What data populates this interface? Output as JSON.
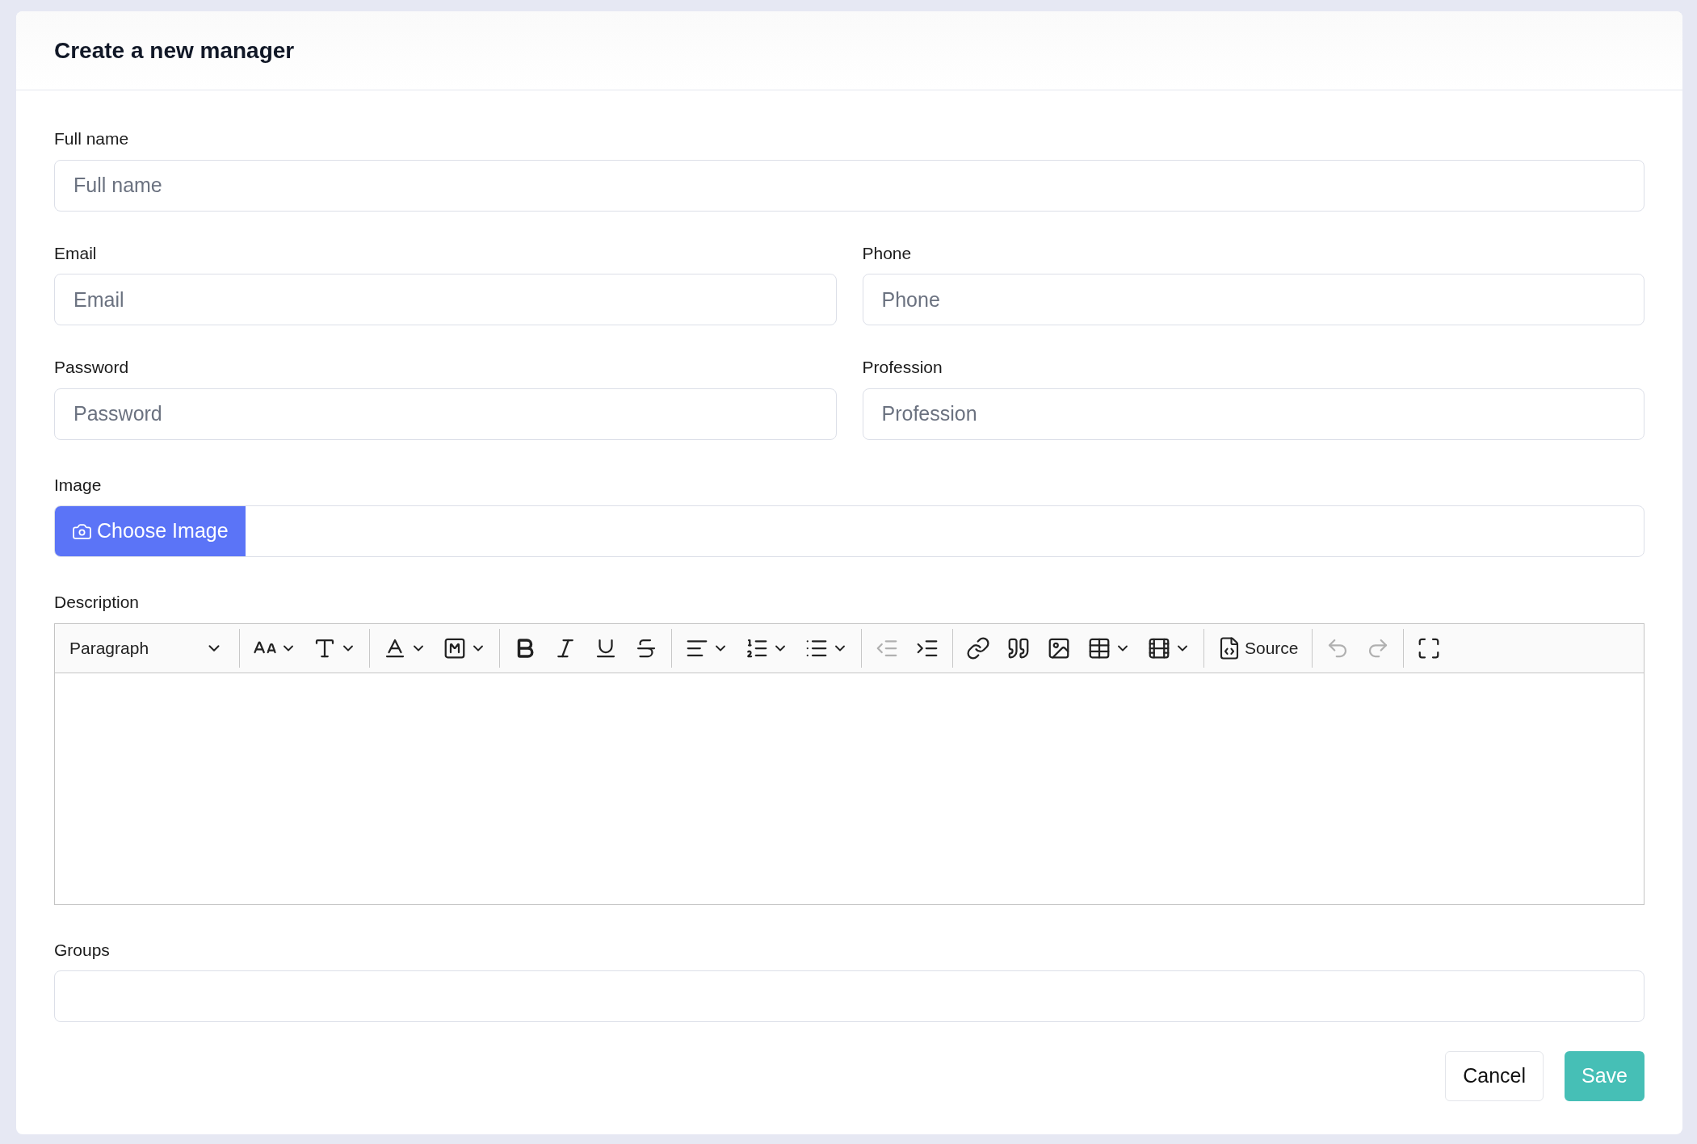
{
  "title": "Create a new manager",
  "full_name": {
    "label": "Full name",
    "placeholder": "Full name"
  },
  "row_fields": [
    [
      {
        "label": "Email",
        "placeholder": "Email"
      },
      {
        "label": "Phone",
        "placeholder": "Phone"
      }
    ],
    [
      {
        "label": "Password",
        "placeholder": "Password"
      },
      {
        "label": "Profession",
        "placeholder": "Profession"
      }
    ]
  ],
  "image": {
    "label": "Image",
    "button": "Choose Image"
  },
  "description": {
    "label": "Description",
    "toolbar": [
      {
        "kind": "heading",
        "text": "Paragraph"
      },
      {
        "kind": "separator"
      },
      {
        "kind": "font-size",
        "dropdown": true,
        "disabled": false
      },
      {
        "kind": "font-family",
        "dropdown": true,
        "disabled": false
      },
      {
        "kind": "separator"
      },
      {
        "kind": "font-color",
        "dropdown": true,
        "disabled": false
      },
      {
        "kind": "highlight",
        "dropdown": true,
        "disabled": false
      },
      {
        "kind": "separator"
      },
      {
        "kind": "bold",
        "dropdown": false,
        "disabled": false
      },
      {
        "kind": "italic",
        "dropdown": false,
        "disabled": false
      },
      {
        "kind": "underline",
        "dropdown": false,
        "disabled": false
      },
      {
        "kind": "strike",
        "dropdown": false,
        "disabled": false
      },
      {
        "kind": "separator"
      },
      {
        "kind": "align",
        "dropdown": true,
        "disabled": false
      },
      {
        "kind": "ordered-list",
        "dropdown": true,
        "disabled": false
      },
      {
        "kind": "bullet-list",
        "dropdown": true,
        "disabled": false
      },
      {
        "kind": "separator"
      },
      {
        "kind": "outdent",
        "dropdown": false,
        "disabled": true
      },
      {
        "kind": "indent",
        "dropdown": false,
        "disabled": false
      },
      {
        "kind": "separator"
      },
      {
        "kind": "link",
        "dropdown": false,
        "disabled": false
      },
      {
        "kind": "quote",
        "dropdown": false,
        "disabled": false
      },
      {
        "kind": "image",
        "dropdown": false,
        "disabled": false
      },
      {
        "kind": "table",
        "dropdown": true,
        "disabled": false
      },
      {
        "kind": "media",
        "dropdown": true,
        "disabled": false
      },
      {
        "kind": "separator"
      },
      {
        "kind": "source",
        "text": "Source",
        "disabled": false
      },
      {
        "kind": "separator"
      },
      {
        "kind": "undo",
        "dropdown": false,
        "disabled": true
      },
      {
        "kind": "redo",
        "dropdown": false,
        "disabled": true
      },
      {
        "kind": "separator"
      },
      {
        "kind": "fullscreen",
        "dropdown": false,
        "disabled": false
      }
    ]
  },
  "groups": {
    "label": "Groups"
  },
  "buttons": {
    "cancel": "Cancel",
    "save": "Save"
  }
}
